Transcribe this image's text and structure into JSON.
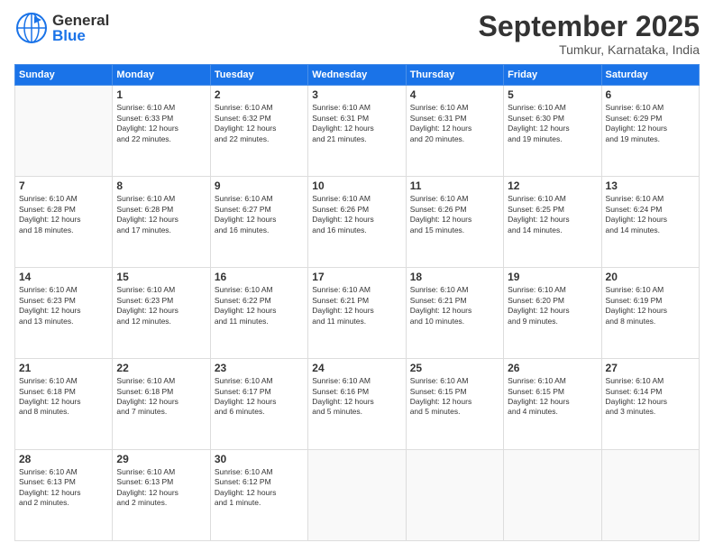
{
  "logo": {
    "general": "General",
    "blue": "Blue"
  },
  "header": {
    "month": "September 2025",
    "location": "Tumkur, Karnataka, India"
  },
  "days_of_week": [
    "Sunday",
    "Monday",
    "Tuesday",
    "Wednesday",
    "Thursday",
    "Friday",
    "Saturday"
  ],
  "weeks": [
    [
      {
        "day": "",
        "info": ""
      },
      {
        "day": "1",
        "info": "Sunrise: 6:10 AM\nSunset: 6:33 PM\nDaylight: 12 hours\nand 22 minutes."
      },
      {
        "day": "2",
        "info": "Sunrise: 6:10 AM\nSunset: 6:32 PM\nDaylight: 12 hours\nand 22 minutes."
      },
      {
        "day": "3",
        "info": "Sunrise: 6:10 AM\nSunset: 6:31 PM\nDaylight: 12 hours\nand 21 minutes."
      },
      {
        "day": "4",
        "info": "Sunrise: 6:10 AM\nSunset: 6:31 PM\nDaylight: 12 hours\nand 20 minutes."
      },
      {
        "day": "5",
        "info": "Sunrise: 6:10 AM\nSunset: 6:30 PM\nDaylight: 12 hours\nand 19 minutes."
      },
      {
        "day": "6",
        "info": "Sunrise: 6:10 AM\nSunset: 6:29 PM\nDaylight: 12 hours\nand 19 minutes."
      }
    ],
    [
      {
        "day": "7",
        "info": "Sunrise: 6:10 AM\nSunset: 6:28 PM\nDaylight: 12 hours\nand 18 minutes."
      },
      {
        "day": "8",
        "info": "Sunrise: 6:10 AM\nSunset: 6:28 PM\nDaylight: 12 hours\nand 17 minutes."
      },
      {
        "day": "9",
        "info": "Sunrise: 6:10 AM\nSunset: 6:27 PM\nDaylight: 12 hours\nand 16 minutes."
      },
      {
        "day": "10",
        "info": "Sunrise: 6:10 AM\nSunset: 6:26 PM\nDaylight: 12 hours\nand 16 minutes."
      },
      {
        "day": "11",
        "info": "Sunrise: 6:10 AM\nSunset: 6:26 PM\nDaylight: 12 hours\nand 15 minutes."
      },
      {
        "day": "12",
        "info": "Sunrise: 6:10 AM\nSunset: 6:25 PM\nDaylight: 12 hours\nand 14 minutes."
      },
      {
        "day": "13",
        "info": "Sunrise: 6:10 AM\nSunset: 6:24 PM\nDaylight: 12 hours\nand 14 minutes."
      }
    ],
    [
      {
        "day": "14",
        "info": "Sunrise: 6:10 AM\nSunset: 6:23 PM\nDaylight: 12 hours\nand 13 minutes."
      },
      {
        "day": "15",
        "info": "Sunrise: 6:10 AM\nSunset: 6:23 PM\nDaylight: 12 hours\nand 12 minutes."
      },
      {
        "day": "16",
        "info": "Sunrise: 6:10 AM\nSunset: 6:22 PM\nDaylight: 12 hours\nand 11 minutes."
      },
      {
        "day": "17",
        "info": "Sunrise: 6:10 AM\nSunset: 6:21 PM\nDaylight: 12 hours\nand 11 minutes."
      },
      {
        "day": "18",
        "info": "Sunrise: 6:10 AM\nSunset: 6:21 PM\nDaylight: 12 hours\nand 10 minutes."
      },
      {
        "day": "19",
        "info": "Sunrise: 6:10 AM\nSunset: 6:20 PM\nDaylight: 12 hours\nand 9 minutes."
      },
      {
        "day": "20",
        "info": "Sunrise: 6:10 AM\nSunset: 6:19 PM\nDaylight: 12 hours\nand 8 minutes."
      }
    ],
    [
      {
        "day": "21",
        "info": "Sunrise: 6:10 AM\nSunset: 6:18 PM\nDaylight: 12 hours\nand 8 minutes."
      },
      {
        "day": "22",
        "info": "Sunrise: 6:10 AM\nSunset: 6:18 PM\nDaylight: 12 hours\nand 7 minutes."
      },
      {
        "day": "23",
        "info": "Sunrise: 6:10 AM\nSunset: 6:17 PM\nDaylight: 12 hours\nand 6 minutes."
      },
      {
        "day": "24",
        "info": "Sunrise: 6:10 AM\nSunset: 6:16 PM\nDaylight: 12 hours\nand 5 minutes."
      },
      {
        "day": "25",
        "info": "Sunrise: 6:10 AM\nSunset: 6:15 PM\nDaylight: 12 hours\nand 5 minutes."
      },
      {
        "day": "26",
        "info": "Sunrise: 6:10 AM\nSunset: 6:15 PM\nDaylight: 12 hours\nand 4 minutes."
      },
      {
        "day": "27",
        "info": "Sunrise: 6:10 AM\nSunset: 6:14 PM\nDaylight: 12 hours\nand 3 minutes."
      }
    ],
    [
      {
        "day": "28",
        "info": "Sunrise: 6:10 AM\nSunset: 6:13 PM\nDaylight: 12 hours\nand 2 minutes."
      },
      {
        "day": "29",
        "info": "Sunrise: 6:10 AM\nSunset: 6:13 PM\nDaylight: 12 hours\nand 2 minutes."
      },
      {
        "day": "30",
        "info": "Sunrise: 6:10 AM\nSunset: 6:12 PM\nDaylight: 12 hours\nand 1 minute."
      },
      {
        "day": "",
        "info": ""
      },
      {
        "day": "",
        "info": ""
      },
      {
        "day": "",
        "info": ""
      },
      {
        "day": "",
        "info": ""
      }
    ]
  ]
}
